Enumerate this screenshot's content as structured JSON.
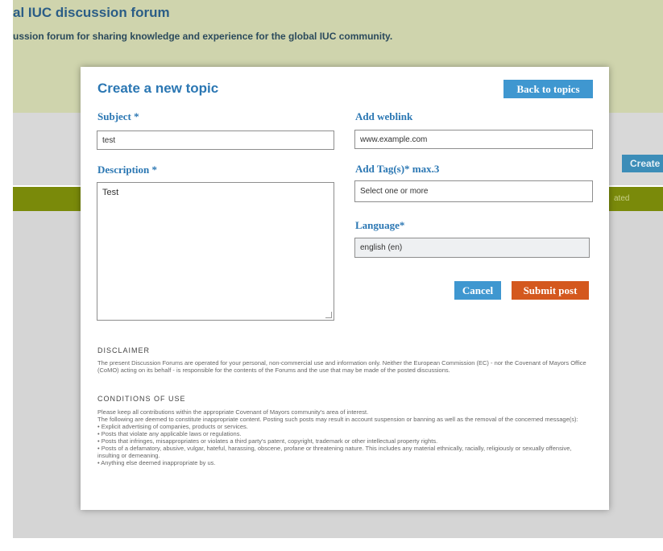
{
  "background": {
    "title": "al IUC discussion forum",
    "subtitle": "ussion forum for sharing knowledge and experience for the global IUC community.",
    "create_button": "Create",
    "green_bar_text": "ated"
  },
  "modal": {
    "title": "Create a new topic",
    "back_button": "Back to topics",
    "subject": {
      "label": "Subject *",
      "value": "test"
    },
    "description": {
      "label": "Description *",
      "value": "Test"
    },
    "weblink": {
      "label": "Add weblink",
      "value": "www.example.com"
    },
    "tags": {
      "label": "Add Tag(s)* max.3",
      "value": "Select one or more"
    },
    "language": {
      "label": "Language*",
      "value": "english (en)"
    },
    "cancel_button": "Cancel",
    "submit_button": "Submit post",
    "disclaimer": {
      "heading": "DISCLAIMER",
      "text": "The present Discussion Forums are operated for your personal, non-commercial use and information only. Neither the European Commission (EC) - nor the Covenant of Mayors Office (CoMO) acting on its behalf - is responsible for the contents of the Forums and the use that may be made of the posted discussions."
    },
    "conditions": {
      "heading": "CONDITIONS OF USE",
      "lines": [
        "Please keep all contributions within the appropriate Covenant of Mayors community's area of interest.",
        "The following are deemed to constitute inappropriate content. Posting such posts may result in account suspension or banning as well as the removal of the concerned message(s):",
        "• Explicit advertising of companies, products or services.",
        "• Posts that violate any applicable laws or regulations.",
        "• Posts that infringes, misappropriates or violates a third party's patent, copyright, trademark or other intellectual property rights.",
        "• Posts of a defamatory, abusive, vulgar, hateful, harassing, obscene, profane or threatening nature. This includes any material ethnically, racially, religiously or sexually offensive, insulting or demeaning.",
        "• Anything else deemed inappropriate by us."
      ]
    }
  }
}
